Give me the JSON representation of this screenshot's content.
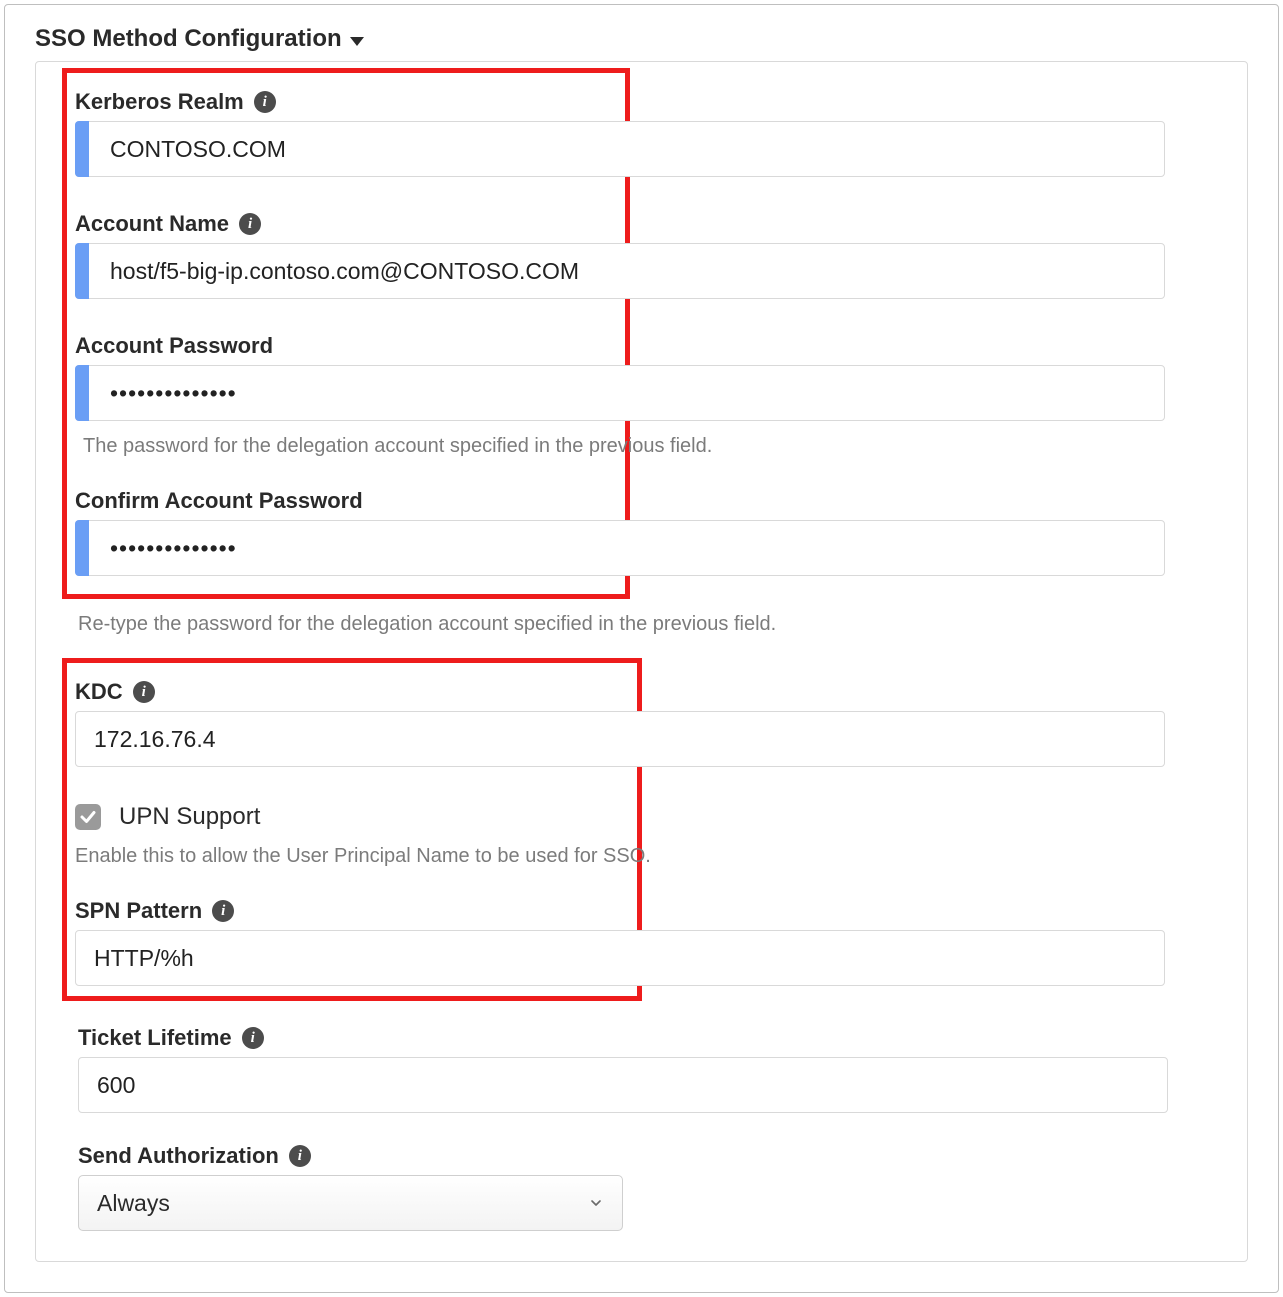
{
  "section": {
    "title": "SSO Method Configuration"
  },
  "fields": {
    "kerberos_realm": {
      "label": "Kerberos Realm",
      "value": "CONTOSO.COM"
    },
    "account_name": {
      "label": "Account Name",
      "value": "host/f5-big-ip.contoso.com@CONTOSO.COM"
    },
    "account_password": {
      "label": "Account Password",
      "value": "••••••••••••••",
      "help": "The password for the delegation account specified in the previous field."
    },
    "confirm_password": {
      "label": "Confirm Account Password",
      "value": "••••••••••••••",
      "help": "Re-type the password for the delegation account specified in the previous field."
    },
    "kdc": {
      "label": "KDC",
      "value": "172.16.76.4"
    },
    "upn_support": {
      "label": "UPN Support",
      "checked": true,
      "help": "Enable this to allow the User Principal Name to be used for SSO."
    },
    "spn_pattern": {
      "label": "SPN Pattern",
      "value": "HTTP/%h"
    },
    "ticket_lifetime": {
      "label": "Ticket Lifetime",
      "value": "600"
    },
    "send_authorization": {
      "label": "Send Authorization",
      "value": "Always"
    }
  },
  "icons": {
    "info_glyph": "i"
  }
}
